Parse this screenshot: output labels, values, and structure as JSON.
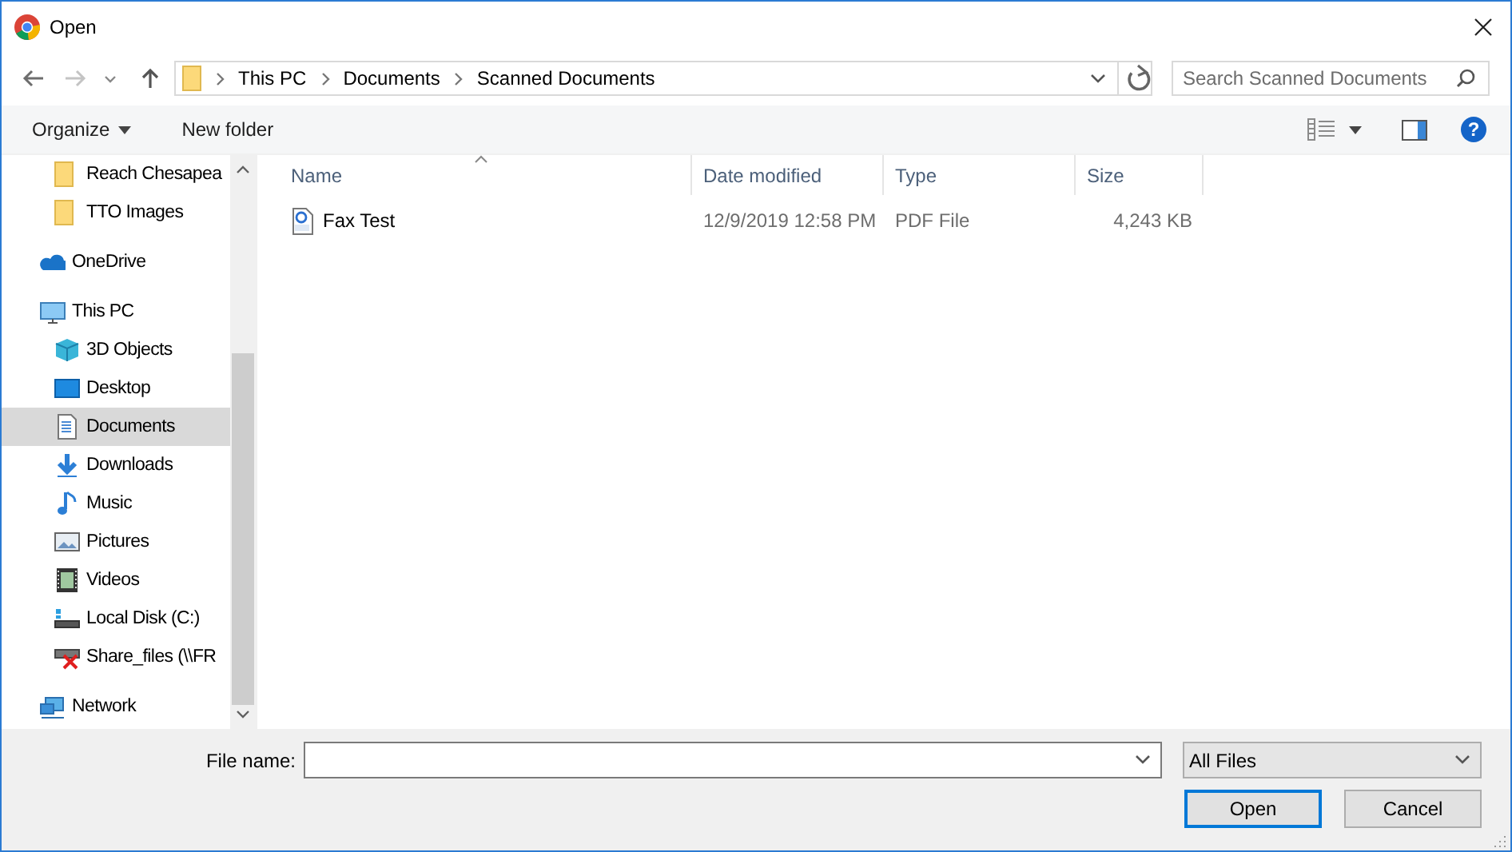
{
  "window": {
    "title": "Open"
  },
  "navigation": {
    "back_enabled": true,
    "forward_enabled": false
  },
  "address_bar": {
    "crumbs": [
      "This PC",
      "Documents",
      "Scanned Documents"
    ]
  },
  "search": {
    "placeholder": "Search Scanned Documents"
  },
  "toolbar": {
    "buttons": [
      {
        "label": "Organize",
        "kind": "menu"
      },
      {
        "label": "New folder",
        "kind": "plain"
      }
    ],
    "help": "?"
  },
  "sidebar": {
    "items": [
      {
        "children": [
          {
            "label": "Reach Chesapea",
            "selected": false
          },
          {
            "label": "TTO Images",
            "selected": false
          }
        ]
      },
      {
        "label": "OneDrive",
        "selected": false
      },
      {
        "label": "This PC",
        "selected": false,
        "children": [
          {
            "label": "3D Objects",
            "selected": false
          },
          {
            "label": "Desktop",
            "selected": false
          },
          {
            "label": "Documents",
            "selected": true
          },
          {
            "label": "Downloads",
            "selected": false
          },
          {
            "label": "Music",
            "selected": false
          },
          {
            "label": "Pictures",
            "selected": false
          },
          {
            "label": "Videos",
            "selected": false
          },
          {
            "label": "Local Disk (C:)",
            "selected": false
          },
          {
            "label": "Share_files (\\\\FR",
            "selected": false
          }
        ]
      },
      {
        "label": "Network",
        "selected": false
      }
    ]
  },
  "file_list": {
    "columns": [
      {
        "label": "Name",
        "sorted": true
      },
      {
        "label": "Date modified",
        "sorted": false
      },
      {
        "label": "Type",
        "sorted": false
      },
      {
        "label": "Size",
        "sorted": false
      }
    ],
    "rows": [
      {
        "cells": [
          "Fax Test",
          "12/9/2019 12:58 PM",
          "PDF File",
          "4,243 KB"
        ],
        "selected": false
      }
    ]
  },
  "file_name": {
    "label": "File name:"
  },
  "filter": {
    "value": "All Files"
  },
  "buttons": [
    {
      "label": "Open",
      "default": true
    },
    {
      "label": "Cancel",
      "default": false
    }
  ]
}
